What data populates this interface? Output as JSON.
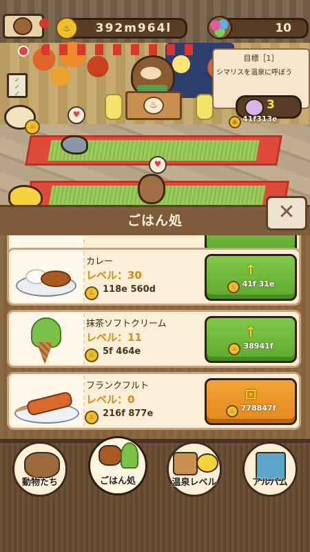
{
  "hud": {
    "coins": "392m964l",
    "coin_glyph": "♨",
    "gems": "10"
  },
  "goal": {
    "title": "目標［1］",
    "description": "シマリスを温泉に呼ぼう",
    "reward": "3",
    "sub_value": "41f313e"
  },
  "panel": {
    "title": "ごはん処",
    "close_glyph": "✕"
  },
  "foods": [
    {
      "name": "カレー",
      "level": "レベル：30",
      "income": "118e 560d",
      "button_type": "upgrade",
      "cost": "41f 31e"
    },
    {
      "name": "抹茶ソフトクリーム",
      "level": "レベル：11",
      "income": "5f 464e",
      "button_type": "upgrade",
      "cost": "38941f"
    },
    {
      "name": "フランクフルト",
      "level": "レベル：0",
      "income": "216f 877e",
      "button_type": "unlock",
      "cost": "778847f"
    }
  ],
  "icons": {
    "upgrade": "↑",
    "unlock": "⊡"
  },
  "nav": [
    {
      "label": "動物たち",
      "icon": "animals-icon",
      "active": false
    },
    {
      "label": "ごはん処",
      "icon": "food-icon",
      "active": true
    },
    {
      "label": "温泉レベル",
      "icon": "onsen-level-icon",
      "active": false
    },
    {
      "label": "アルバム",
      "icon": "album-icon",
      "active": false
    }
  ],
  "colors": {
    "upgrade_button": "#5ea82f",
    "unlock_button": "#e3861c",
    "level_text": "#d88a14",
    "panel_header": "#7e5b3b"
  }
}
